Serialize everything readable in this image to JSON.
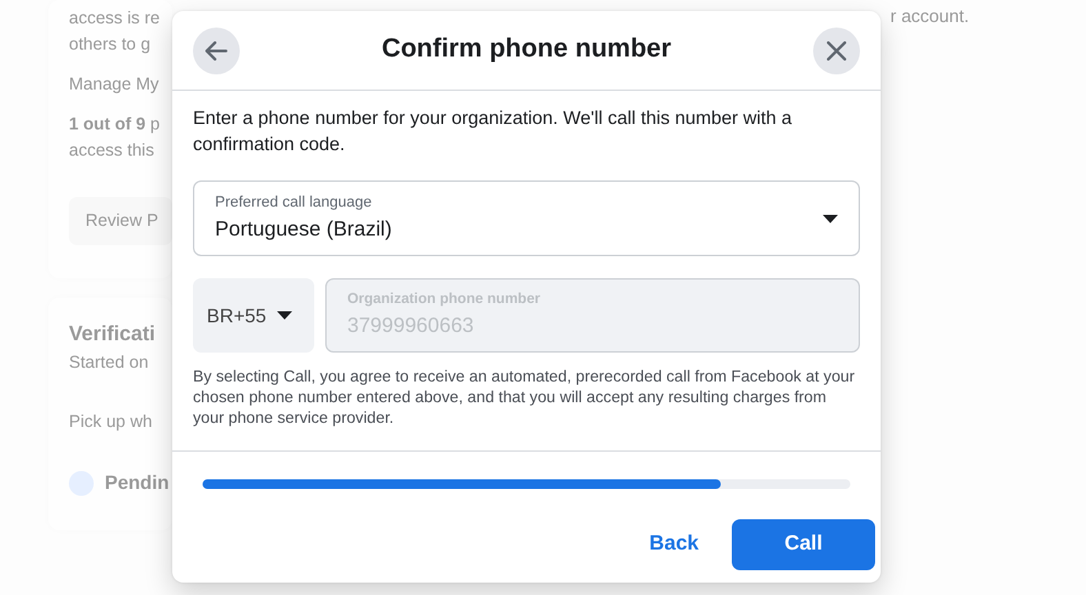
{
  "background": {
    "card_1": {
      "lines": [
        "access is re",
        "others to g",
        "Manage My",
        "**1 out of 9** p",
        "access this"
      ],
      "button": "Review P"
    },
    "card_2": {
      "title": "Verificati",
      "subtitle": "Started on",
      "note": "Pick up wh",
      "status": "Pendin"
    },
    "right_text": "r account."
  },
  "dialog": {
    "title": "Confirm phone number",
    "intro": "Enter a phone number for your organization. We'll call this number with a confirmation code.",
    "language": {
      "label": "Preferred call language",
      "value": "Portuguese (Brazil)"
    },
    "country": {
      "value": "BR+55"
    },
    "phone": {
      "label": "Organization phone number",
      "value": "37999960663",
      "disabled": true
    },
    "disclaimer": "By selecting Call, you agree to receive an automated, prerecorded call from Facebook at your chosen phone number entered above, and that you will accept any resulting charges from your phone service provider.",
    "progress": {
      "level": 0.8
    },
    "buttons": {
      "back": "Back",
      "call": "Call"
    }
  }
}
